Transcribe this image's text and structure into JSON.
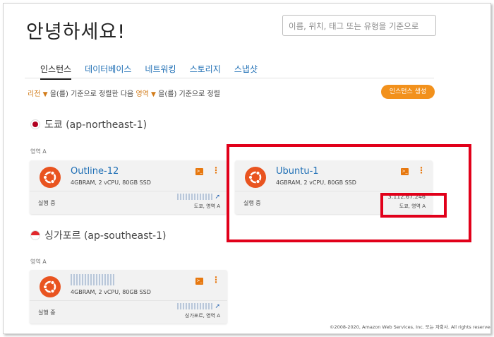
{
  "greeting": "안녕하세요!",
  "search": {
    "placeholder": "이름, 위치, 태그 또는 유형을 기준으로"
  },
  "tabs": [
    {
      "label": "인스턴스",
      "active": true
    },
    {
      "label": "데이터베이스",
      "active": false
    },
    {
      "label": "네트워킹",
      "active": false
    },
    {
      "label": "스토리지",
      "active": false
    },
    {
      "label": "스냅샷",
      "active": false
    }
  ],
  "sort": {
    "field1": "리전",
    "text1": "을(를) 기준으로 정렬한 다음",
    "field2": "영역",
    "text2": "을(를) 기준으로 정렬"
  },
  "create_button": "인스턴스 생성",
  "regions": [
    {
      "name": "도쿄 (ap-northeast-1)",
      "zone_label": "영역 A",
      "instances": [
        {
          "name": "Outline-12",
          "spec": "4GBRAM, 2 vCPU, 80GB SSD",
          "status": "실행 중",
          "ip": "",
          "location": "도쿄, 영역 A"
        },
        {
          "name": "Ubuntu-1",
          "spec": "4GBRAM, 2 vCPU, 80GB SSD",
          "status": "실행 중",
          "ip": "3.112.67.246",
          "location": "도쿄, 영역 A"
        }
      ]
    },
    {
      "name": "싱가포르 (ap-southeast-1)",
      "zone_label": "영역 A",
      "instances": [
        {
          "name": "",
          "spec": "4GBRAM, 2 vCPU, 80GB SSD",
          "status": "실행 중",
          "ip": "",
          "location": "싱가포르, 영역 A"
        }
      ]
    }
  ],
  "footer": "©2008-2020, Amazon Web Services, Inc. 또는 자회사. All rights reserved.",
  "icons": {
    "os": "ubuntu-logo-icon",
    "connect": "terminal-icon",
    "menu": "kebab-menu-icon",
    "pin": "pin-icon"
  },
  "colors": {
    "accent": "#f2911c",
    "link": "#1f6fb5",
    "highlight": "#e1001a",
    "ubuntu": "#e95420"
  }
}
